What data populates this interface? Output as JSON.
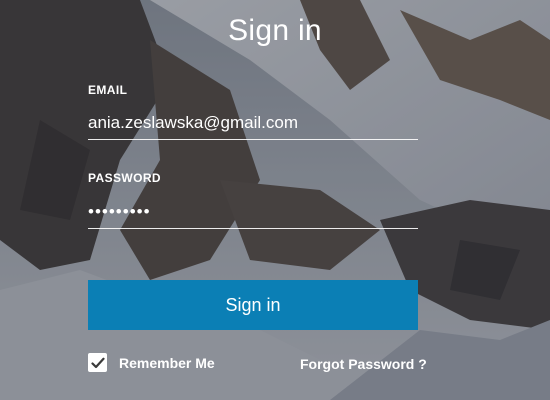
{
  "form": {
    "title": "Sign in",
    "email": {
      "label": "EMAIL",
      "value": "ania.zeslawska@gmail.com"
    },
    "password": {
      "label": "PASSWORD",
      "value": "•••••••••"
    },
    "submit_label": "Sign in",
    "remember_label": "Remember Me",
    "remember_checked": true,
    "forgot_label": "Forgot Password ?"
  },
  "colors": {
    "accent": "#0b7fb5",
    "text": "#ffffff"
  },
  "icons": {
    "checkbox": "checkmark-icon"
  }
}
